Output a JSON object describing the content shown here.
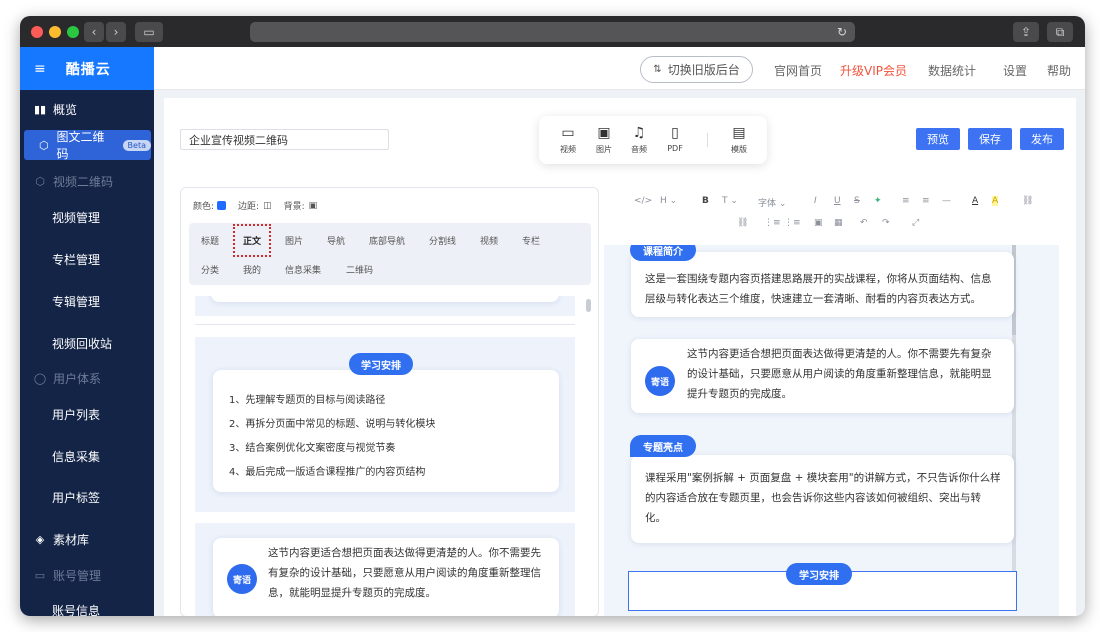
{
  "browser": {
    "back_icon": "chevron-left-icon",
    "forward_icon": "chevron-right-icon",
    "sidebar_icon": "sidebar-toggle-icon",
    "reload_icon": "reload-icon",
    "share_icon": "share-icon",
    "tabs_icon": "tabs-icon"
  },
  "brand": {
    "menu_glyph": "≡",
    "name": "酷播云",
    "color": "#1677ff"
  },
  "sidebar": {
    "items": [
      {
        "label": "概览",
        "icon": "bar-chart-icon",
        "glyph": "▮▮"
      },
      {
        "label": "图文二维码",
        "icon": "cube-icon",
        "glyph": "⬡",
        "badge": "Beta",
        "active": true
      },
      {
        "label": "视频二维码",
        "icon": "cube-icon",
        "glyph": "⬡",
        "group": true
      },
      {
        "label": "视频管理"
      },
      {
        "label": "专栏管理"
      },
      {
        "label": "专辑管理"
      },
      {
        "label": "视频回收站"
      },
      {
        "label": "用户体系",
        "icon": "user-icon",
        "glyph": "◯",
        "group": true
      },
      {
        "label": "用户列表"
      },
      {
        "label": "信息采集"
      },
      {
        "label": "用户标签"
      },
      {
        "label": "素材库",
        "icon": "layers-icon",
        "glyph": "◈"
      },
      {
        "label": "账号管理",
        "icon": "id-card-icon",
        "glyph": "▭",
        "group": true
      },
      {
        "label": "账号信息"
      }
    ]
  },
  "topnav": {
    "switch_label": "切换旧版后台",
    "switch_icon": "swap-icon",
    "links": [
      "官网首页",
      "升级VIP会员",
      "数据统计",
      "设置",
      "帮助"
    ],
    "vip_color": "#f0533b"
  },
  "editor": {
    "title_value": "企业宣传视频二维码",
    "tools": [
      {
        "label": "视频",
        "icon": "video-icon",
        "glyph": "▭"
      },
      {
        "label": "图片",
        "icon": "image-icon",
        "glyph": "▣"
      },
      {
        "label": "音频",
        "icon": "music-icon",
        "glyph": "♫"
      },
      {
        "label": "PDF",
        "icon": "file-icon",
        "glyph": "▯"
      },
      {
        "label": "模版",
        "icon": "template-icon",
        "glyph": "▤"
      }
    ],
    "actions": {
      "preview": "预览",
      "save": "保存",
      "publish": "发布"
    },
    "accent": "#3d73f3"
  },
  "style_row": {
    "color_label": "颜色:",
    "border_label": "边距:",
    "bg_label": "背景:",
    "swatch_color": "#1f6bff"
  },
  "component_tabs": [
    "标题",
    "正文",
    "图片",
    "导航",
    "底部导航",
    "分割线",
    "视频",
    "专栏",
    "分类",
    "我的",
    "信息采集",
    "二维码"
  ],
  "left": {
    "schedule_title": "学习安排",
    "schedule_items": [
      "1、先理解专题页的目标与阅读路径",
      "2、再拆分页面中常见的标题、说明与转化模块",
      "3、结合案例优化文案密度与视觉节奏",
      "4、最后完成一版适合课程推广的内容页结构"
    ],
    "note_badge": "寄语",
    "note_lines": [
      "这节内容更适合想把页面表达做得更清楚的人。你不需要先",
      "有复杂的设计基础，只要愿意从用户阅读的角度重新整理信",
      "息，就能明显提升专题页的完成度。"
    ]
  },
  "rich_toolbar": {
    "row1": [
      "</>",
      "H ⌄",
      "B",
      "T ⌄",
      "字体 ⌄",
      "I",
      "U",
      "S",
      "✦",
      "≡",
      "≡",
      "—",
      "A",
      "A",
      "⛓"
    ],
    "row2": [
      "⛓",
      "⋮≡",
      "⋮≡",
      "▣",
      "▦",
      "↶",
      "↷",
      "⤢"
    ]
  },
  "preview": {
    "intro_title": "课程简介",
    "intro_lines": [
      "这是一套围绕专题内容页搭建思路展开的实战课程，你将从页面结构、信息",
      "层级与转化表达三个维度，快速建立一套清晰、耐看的内容页表达方式。"
    ],
    "note_badge": "寄语",
    "note_lines": [
      "这节内容更适合想把页面表达做得更清楚的人。你不需要先有复杂",
      "的设计基础，只要愿意从用户阅读的角度重新整理信息，就能明显",
      "提升专题页的完成度。"
    ],
    "highlight_title": "专题亮点",
    "highlight_lines": [
      "课程采用\"案例拆解 + 页面复盘 + 模块套用\"的讲解方式，不只告诉你什么样",
      "的内容适合放在专题页里，也会告诉你这些内容该如何被组织、突出与转",
      "化。"
    ],
    "schedule_title": "学习安排"
  }
}
